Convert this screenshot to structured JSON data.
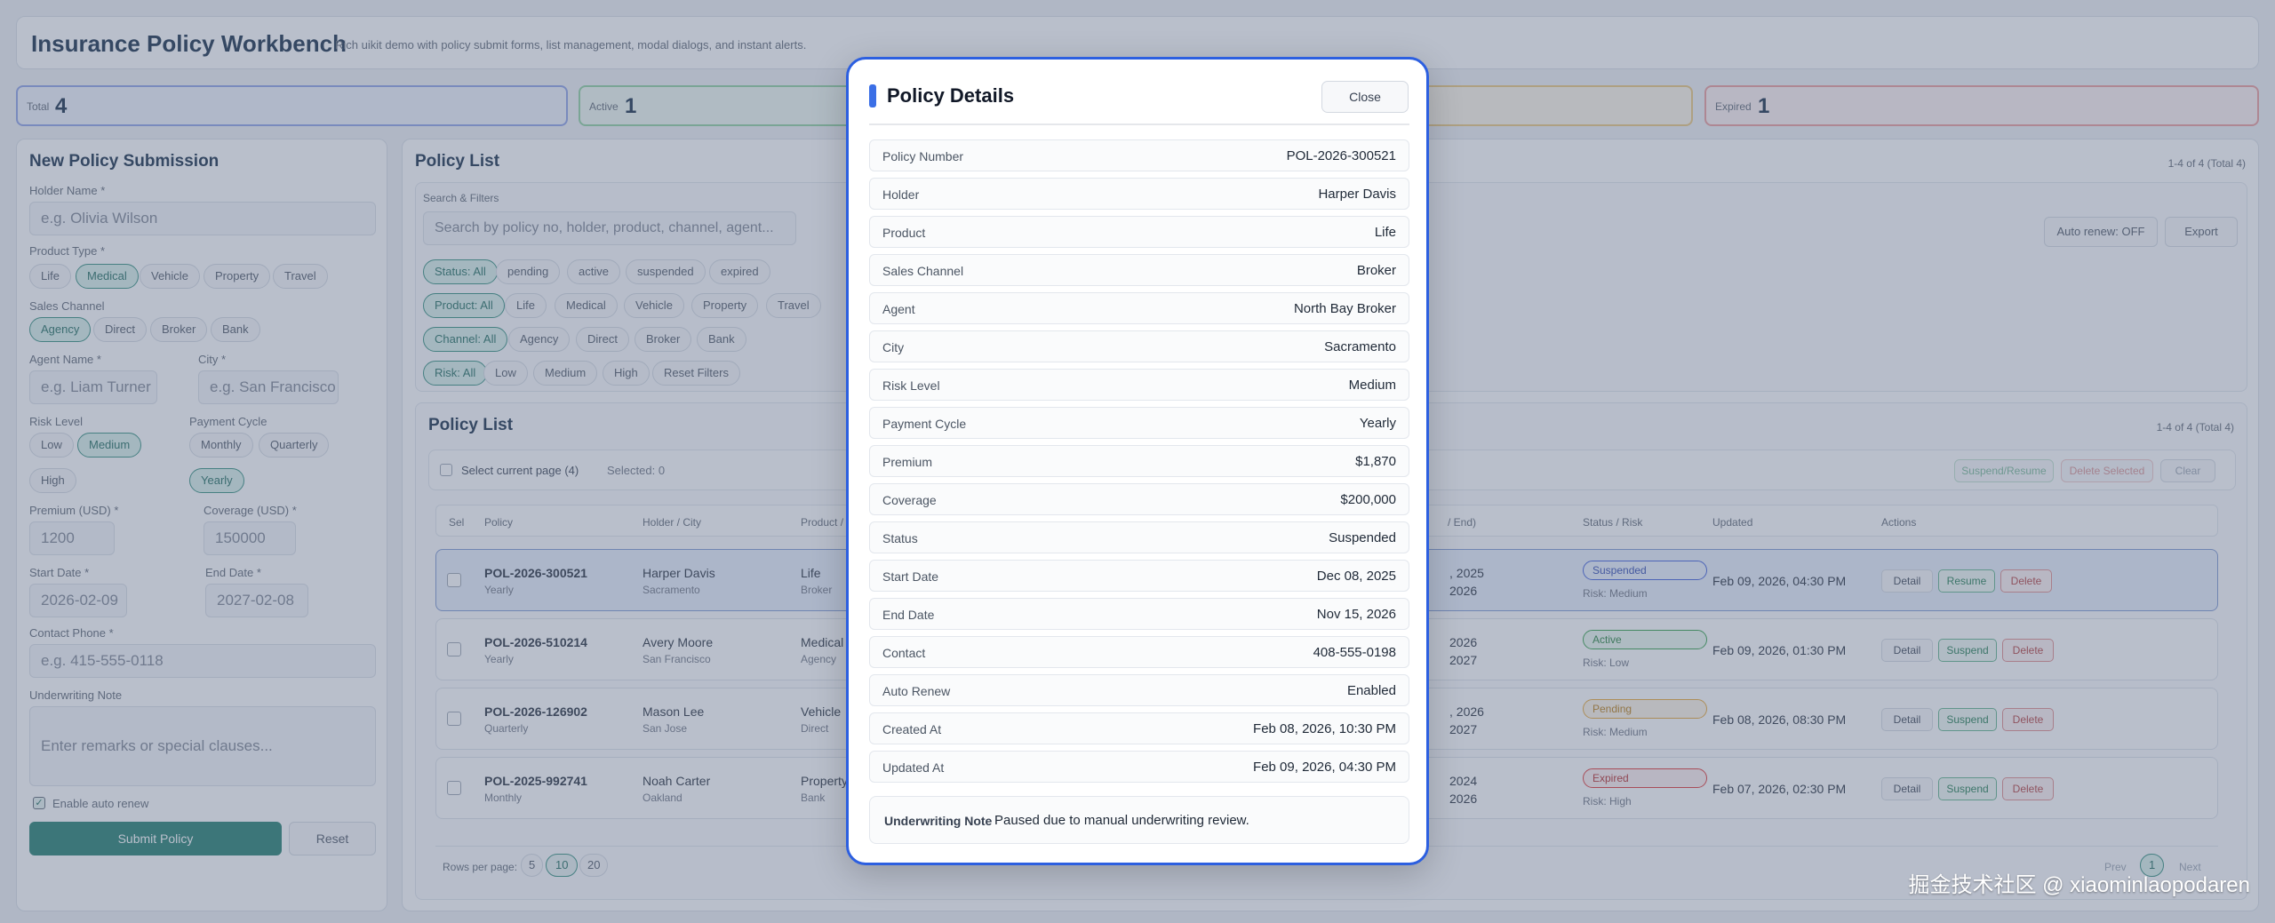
{
  "header": {
    "title": "Insurance Policy Workbench",
    "subtitle": "Rich uikit demo with policy submit forms, list management, modal dialogs, and instant alerts."
  },
  "stats": [
    {
      "label": "Total",
      "value": "4",
      "color": "#3b5bdb"
    },
    {
      "label": "Active",
      "value": "1",
      "color": "#2f9e44"
    },
    {
      "label": "",
      "value": "",
      "color": "#e8a530"
    },
    {
      "label": "Expired",
      "value": "1",
      "color": "#e03131"
    }
  ],
  "form": {
    "title": "New Policy Submission",
    "holder_label": "Holder Name *",
    "holder_placeholder": "e.g. Olivia Wilson",
    "product_label": "Product Type *",
    "products": [
      "Life",
      "Medical",
      "Vehicle",
      "Property",
      "Travel"
    ],
    "channel_label": "Sales Channel",
    "channels": [
      "Agency",
      "Direct",
      "Broker",
      "Bank"
    ],
    "agent_label": "Agent Name *",
    "agent_placeholder": "e.g. Liam Turner",
    "city_label": "City *",
    "city_placeholder": "e.g. San Francisco",
    "risk_label": "Risk Level",
    "risks": [
      "Low",
      "Medium",
      "High"
    ],
    "cycle_label": "Payment Cycle",
    "cycles": [
      "Monthly",
      "Quarterly",
      "Yearly"
    ],
    "premium_label": "Premium (USD) *",
    "premium_value": "1200",
    "coverage_label": "Coverage (USD) *",
    "coverage_value": "150000",
    "start_label": "Start Date *",
    "start_value": "2026-02-09",
    "end_label": "End Date *",
    "end_value": "2027-02-08",
    "phone_label": "Contact Phone *",
    "phone_placeholder": "e.g. 415-555-0118",
    "note_label": "Underwriting Note",
    "note_placeholder": "Enter remarks or special clauses...",
    "auto_renew_label": "Enable auto renew",
    "submit_label": "Submit Policy",
    "reset_label": "Reset"
  },
  "list": {
    "title": "Policy List",
    "count": "1-4 of 4 (Total 4)",
    "filters_label": "Search & Filters",
    "search_placeholder": "Search by policy no, holder, product, channel, agent...",
    "status_filters": [
      "Status: All",
      "pending",
      "active",
      "suspended",
      "expired"
    ],
    "product_filters": [
      "Product: All",
      "Life",
      "Medical",
      "Vehicle",
      "Property",
      "Travel"
    ],
    "channel_filters": [
      "Channel: All",
      "Agency",
      "Direct",
      "Broker",
      "Bank"
    ],
    "risk_filters": [
      "Risk: All",
      "Low",
      "Medium",
      "High",
      "Reset Filters"
    ],
    "auto_renew_btn": "Auto renew: OFF",
    "export_btn": "Export",
    "inner_title": "Policy List",
    "inner_count": "1-4 of 4 (Total 4)",
    "select_page": "Select current page (4)",
    "selected": "Selected: 0",
    "bulk_suspend": "Suspend/Resume",
    "bulk_delete": "Delete Selected",
    "bulk_clear": "Clear",
    "columns": {
      "sel": "Sel",
      "policy": "Policy",
      "holder": "Holder / City",
      "product": "Product /",
      "period": "/ End)",
      "status": "Status / Risk",
      "updated": "Updated",
      "actions": "Actions"
    },
    "rows": [
      {
        "policy": "POL-2026-300521",
        "cycle": "Yearly",
        "holder": "Harper Davis",
        "city": "Sacramento",
        "product": "Life",
        "channel": "Broker",
        "start": ", 2025",
        "end": "2026",
        "status": "Suspended",
        "risk": "Risk: Medium",
        "updated": "Feb 09, 2026, 04:30 PM",
        "act2": "Resume",
        "status_color": "#3b5bdb"
      },
      {
        "policy": "POL-2026-510214",
        "cycle": "Yearly",
        "holder": "Avery Moore",
        "city": "San Francisco",
        "product": "Medical",
        "channel": "Agency",
        "start": "2026",
        "end": "2027",
        "status": "Active",
        "risk": "Risk: Low",
        "updated": "Feb 09, 2026, 01:30 PM",
        "act2": "Suspend",
        "status_color": "#2f9e44"
      },
      {
        "policy": "POL-2026-126902",
        "cycle": "Quarterly",
        "holder": "Mason Lee",
        "city": "San Jose",
        "product": "Vehicle",
        "channel": "Direct",
        "start": ", 2026",
        "end": "2027",
        "status": "Pending",
        "risk": "Risk: Medium",
        "updated": "Feb 08, 2026, 08:30 PM",
        "act2": "Suspend",
        "status_color": "#e8a530"
      },
      {
        "policy": "POL-2025-992741",
        "cycle": "Monthly",
        "holder": "Noah Carter",
        "city": "Oakland",
        "product": "Property",
        "channel": "Bank",
        "start": "2024",
        "end": "2026",
        "status": "Expired",
        "risk": "Risk: High",
        "updated": "Feb 07, 2026, 02:30 PM",
        "act2": "Suspend",
        "status_color": "#e03131"
      }
    ],
    "act_detail": "Detail",
    "act_delete": "Delete",
    "rows_per_page": "Rows per page:",
    "page_sizes": [
      "5",
      "10",
      "20"
    ],
    "prev": "Prev",
    "page": "1",
    "next": "Next"
  },
  "modal": {
    "title": "Policy Details",
    "close": "Close",
    "fields": [
      {
        "k": "Policy Number",
        "v": "POL-2026-300521"
      },
      {
        "k": "Holder",
        "v": "Harper Davis"
      },
      {
        "k": "Product",
        "v": "Life"
      },
      {
        "k": "Sales Channel",
        "v": "Broker"
      },
      {
        "k": "Agent",
        "v": "North Bay Broker"
      },
      {
        "k": "City",
        "v": "Sacramento"
      },
      {
        "k": "Risk Level",
        "v": "Medium"
      },
      {
        "k": "Payment Cycle",
        "v": "Yearly"
      },
      {
        "k": "Premium",
        "v": "$1,870"
      },
      {
        "k": "Coverage",
        "v": "$200,000"
      },
      {
        "k": "Status",
        "v": "Suspended"
      },
      {
        "k": "Start Date",
        "v": "Dec 08, 2025"
      },
      {
        "k": "End Date",
        "v": "Nov 15, 2026"
      },
      {
        "k": "Contact",
        "v": "408-555-0198"
      },
      {
        "k": "Auto Renew",
        "v": "Enabled"
      },
      {
        "k": "Created At",
        "v": "Feb 08, 2026, 10:30 PM"
      },
      {
        "k": "Updated At",
        "v": "Feb 09, 2026, 04:30 PM"
      }
    ],
    "note_label": "Underwriting Note",
    "note_value": "Paused due to manual underwriting review."
  },
  "watermark": "掘金技术社区 @ xiaominlaopodaren"
}
